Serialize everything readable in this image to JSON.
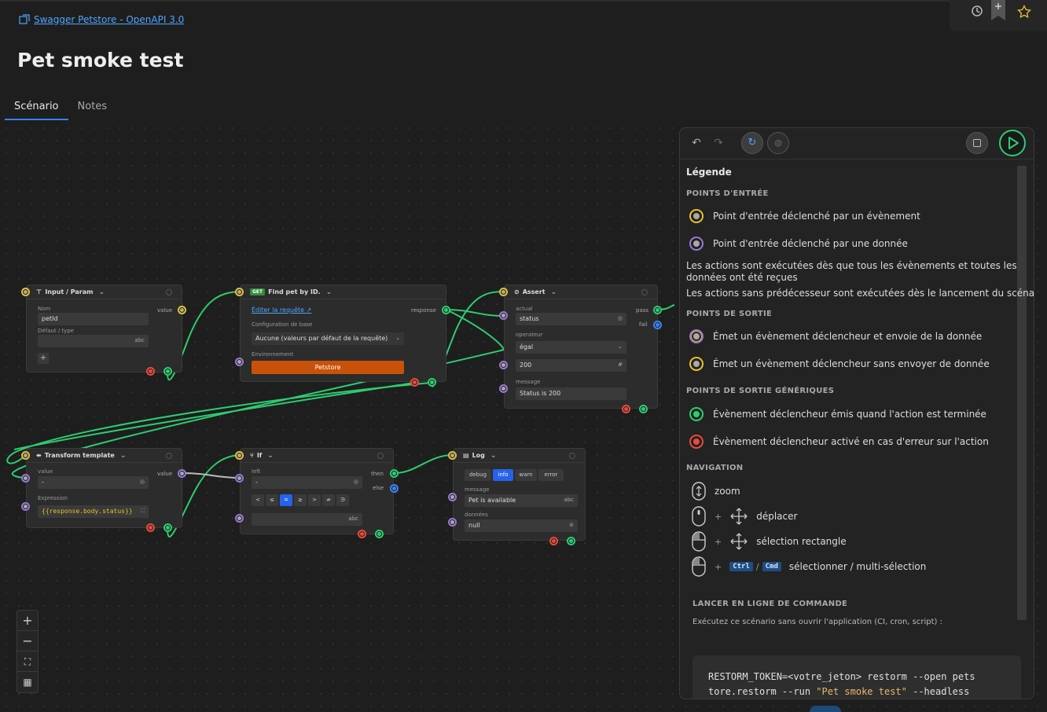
{
  "breadcrumb": {
    "label": "Swagger Petstore - OpenAPI 3.0"
  },
  "page": {
    "title": "Pet smoke test"
  },
  "tabs": [
    {
      "label": "Scénario"
    },
    {
      "label": "Notes"
    }
  ],
  "nodes": {
    "input": {
      "title": "Input / Param",
      "nom_label": "Nom",
      "nom_value": "petId",
      "default_label": "Défaut / type",
      "default_suffix": "abc",
      "value_port": "value"
    },
    "find": {
      "method": "GET",
      "title": "Find pet by ID.",
      "edit_link": "Éditer la requête",
      "config_label": "Configuration de base",
      "config_value": "Aucune (valeurs par défaut de la requête)",
      "env_label": "Environnement",
      "env_button": "Petstore",
      "response_port": "response"
    },
    "assert": {
      "title": "Assert",
      "actual_label": "actual",
      "actual_value": "status",
      "operator_label": "operateur",
      "operator_value": "égal",
      "expected_value": "200",
      "message_label": "message",
      "message_value": "Status is 200",
      "pass_port": "pass",
      "fail_port": "fail"
    },
    "transform": {
      "title": "Transform template",
      "value_label": "value",
      "value_field": "-",
      "value_port": "value",
      "expression_label": "Expression",
      "expression_value": "{{response.body.status}}"
    },
    "if": {
      "title": "If",
      "left_label": "left",
      "left_value": "-",
      "then_port": "then",
      "else_port": "else",
      "right_suffix": "abc",
      "ops": [
        "<",
        "≤",
        "=",
        "≥",
        ">",
        "≠",
        "∋"
      ]
    },
    "log": {
      "title": "Log",
      "levels": [
        "debug",
        "info",
        "warn",
        "error"
      ],
      "message_label": "message",
      "message_value": "Pet is available",
      "message_suffix": "abc",
      "data_label": "données",
      "data_value": "null"
    }
  },
  "panel": {
    "legend_title": "Légende",
    "entry_title": "POINTS D'ENTRÉE",
    "entry_event": "Point d'entrée déclenché par un évènement",
    "entry_data": "Point d'entrée déclenché par une donnée",
    "actions_text_1": "Les actions sont exécutées dès que tous les évènements et toutes les données ont été reçues",
    "actions_text_2": "Les actions sans prédécesseur sont exécutées dès le lancement du scénario",
    "exit_title": "POINTS DE SORTIE",
    "exit_event_data": "Émet un évènement déclencheur et envoie de la donnée",
    "exit_event": "Émet un évènement déclencheur sans envoyer de donnée",
    "generic_title": "POINTS DE SORTIE GÉNÉRIQUES",
    "generic_done": "Évènement déclencheur émis quand l'action est terminée",
    "generic_error": "Évènement déclencheur activé en cas d'erreur sur l'action",
    "nav_title": "NAVIGATION",
    "nav_zoom": "zoom",
    "nav_move": "déplacer",
    "nav_rect": "sélection rectangle",
    "nav_select": "sélectionner / multi-sélection",
    "kbd_ctrl": "Ctrl",
    "kbd_cmd": "Cmd",
    "cli_title": "LANCER EN LIGNE DE COMMANDE",
    "cli_desc": "Exécutez ce scénario sans ouvrir l'application (CI, cron, script) :",
    "cli_line1": "RESTORM_TOKEN=<votre_jeton> restorm --open pets",
    "cli_line2a": "tore.restorm --run ",
    "cli_line2b": "\"Pet smoke test\"",
    "cli_line2c": " --headless"
  },
  "colors": {
    "wire": "#2ecc71",
    "accent": "#3b82f6",
    "orange": "#c9520a"
  }
}
